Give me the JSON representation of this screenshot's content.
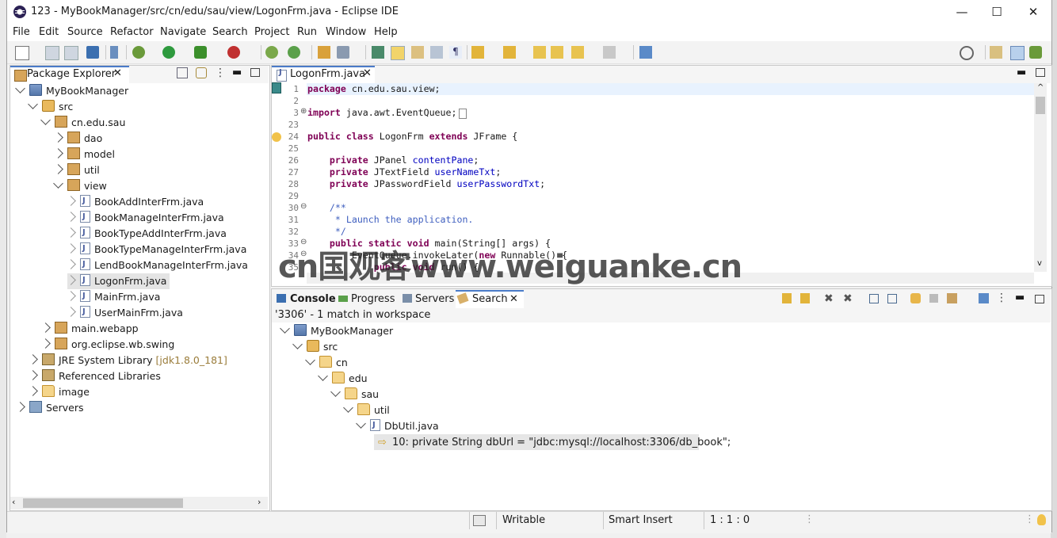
{
  "window": {
    "title": "123 - MyBookManager/src/cn/edu/sau/view/LogonFrm.java - Eclipse IDE",
    "minimize": "—",
    "maximize": "☐",
    "close": "✕"
  },
  "menu": [
    "File",
    "Edit",
    "Source",
    "Refactor",
    "Navigate",
    "Search",
    "Project",
    "Run",
    "Window",
    "Help"
  ],
  "package_explorer": {
    "tab_label": "Package Explorer",
    "tree": [
      {
        "label": "MyBookManager",
        "icon": "project-icon"
      },
      {
        "label": "src",
        "icon": "source-folder-icon"
      },
      {
        "label": "cn.edu.sau",
        "icon": "package-icon"
      },
      {
        "label": "dao",
        "icon": "package-icon"
      },
      {
        "label": "model",
        "icon": "package-icon"
      },
      {
        "label": "util",
        "icon": "package-icon"
      },
      {
        "label": "view",
        "icon": "package-icon"
      },
      {
        "label": "BookAddInterFrm.java",
        "icon": "java-file-icon"
      },
      {
        "label": "BookManageInterFrm.java",
        "icon": "java-file-icon"
      },
      {
        "label": "BookTypeAddInterFrm.java",
        "icon": "java-file-icon"
      },
      {
        "label": "BookTypeManageInterFrm.java",
        "icon": "java-file-icon"
      },
      {
        "label": "LendBookManageInterFrm.java",
        "icon": "java-file-icon"
      },
      {
        "label": "LogonFrm.java",
        "icon": "java-file-icon"
      },
      {
        "label": "MainFrm.java",
        "icon": "java-file-icon"
      },
      {
        "label": "UserMainFrm.java",
        "icon": "java-file-icon"
      },
      {
        "label": "main.webapp",
        "icon": "package-icon"
      },
      {
        "label": "org.eclipse.wb.swing",
        "icon": "package-icon"
      },
      {
        "label": "JRE System Library",
        "icon": "library-icon",
        "suffix": "[jdk1.8.0_181]"
      },
      {
        "label": "Referenced Libraries",
        "icon": "library-icon"
      },
      {
        "label": "image",
        "icon": "folder-icon"
      },
      {
        "label": "Servers",
        "icon": "servers-icon"
      }
    ]
  },
  "editor": {
    "tab_label": "LogonFrm.java",
    "line_numbers": [
      "1",
      "2",
      "3",
      "23",
      "24",
      "25",
      "26",
      "27",
      "28",
      "29",
      "30",
      "31",
      "32",
      "33",
      "34",
      "35"
    ],
    "lines": [
      {
        "kw": "package",
        "rest": " cn.edu.sau.view;"
      },
      {
        "kw": "",
        "rest": ""
      },
      {
        "kw": "import",
        "rest": " java.awt.EventQueue;"
      },
      {
        "kw": "",
        "rest": ""
      },
      {
        "kw": "public class",
        "rest": " LogonFrm ",
        "kw2": "extends",
        "rest2": " JFrame {"
      },
      {
        "kw": "",
        "rest": ""
      },
      {
        "kw": "    private",
        "rest": " JPanel ",
        "field": "contentPane",
        "end": ";"
      },
      {
        "kw": "    private",
        "rest": " JTextField ",
        "field": "userNameTxt",
        "end": ";"
      },
      {
        "kw": "    private",
        "rest": " JPasswordField ",
        "field": "userPasswordTxt",
        "end": ";"
      },
      {
        "kw": "",
        "rest": ""
      },
      {
        "comment": "    /**"
      },
      {
        "comment": "     * Launch the application."
      },
      {
        "comment": "     */"
      },
      {
        "kw": "    public static void",
        "rest": " main(String[] args) {"
      },
      {
        "kw": "",
        "rest": "        EventQueue.invokeLater(",
        "kw2": "new",
        "rest2": " Runnable() {"
      },
      {
        "kw": "            public void",
        "rest": " run() {"
      }
    ]
  },
  "bottom_tabs": [
    "Console",
    "Progress",
    "Servers",
    "Search"
  ],
  "search": {
    "summary": "'3306' - 1 match in workspace",
    "tree": [
      "MyBookManager",
      "src",
      "cn",
      "edu",
      "sau",
      "util",
      "DbUtil.java"
    ],
    "match": "10: private String dbUrl = \"jdbc:mysql://localhost:3306/db_book\";"
  },
  "status": {
    "writable": "Writable",
    "insert_mode": "Smart Insert",
    "position": "1 : 1 : 0"
  },
  "watermark": "cn国观客www.weiguanke.cn"
}
